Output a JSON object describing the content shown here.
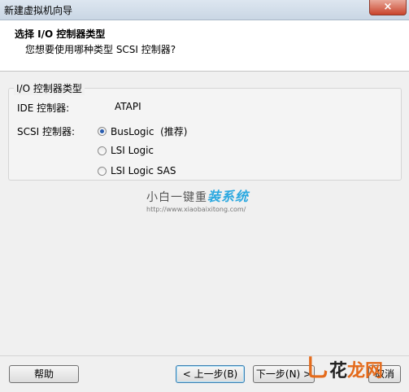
{
  "window": {
    "title": "新建虚拟机向导",
    "close_icon": "×"
  },
  "header": {
    "title": "选择 I/O 控制器类型",
    "subtitle": "您想要使用哪种类型 SCSI 控制器?"
  },
  "group": {
    "legend": "I/O 控制器类型",
    "ide_label": "IDE 控制器:",
    "ide_value": "ATAPI",
    "scsi_label": "SCSI 控制器:",
    "options": [
      {
        "label": "BusLogic  (推荐)",
        "checked": true
      },
      {
        "label": "LSI Logic",
        "checked": false
      },
      {
        "label": "LSI Logic SAS",
        "checked": false
      }
    ]
  },
  "watermark": {
    "brand_prefix": "小白一键重",
    "brand_accent": "装系统",
    "url": "http://www.xiaobaixitong.com/"
  },
  "footer": {
    "help_label": "帮助",
    "back_label": "< 上一步(B)",
    "next_label": "下一步(N) >",
    "cancel_label": "取消"
  },
  "site_mark": {
    "hook": "乚",
    "name": "花",
    "sub": "龙网"
  }
}
